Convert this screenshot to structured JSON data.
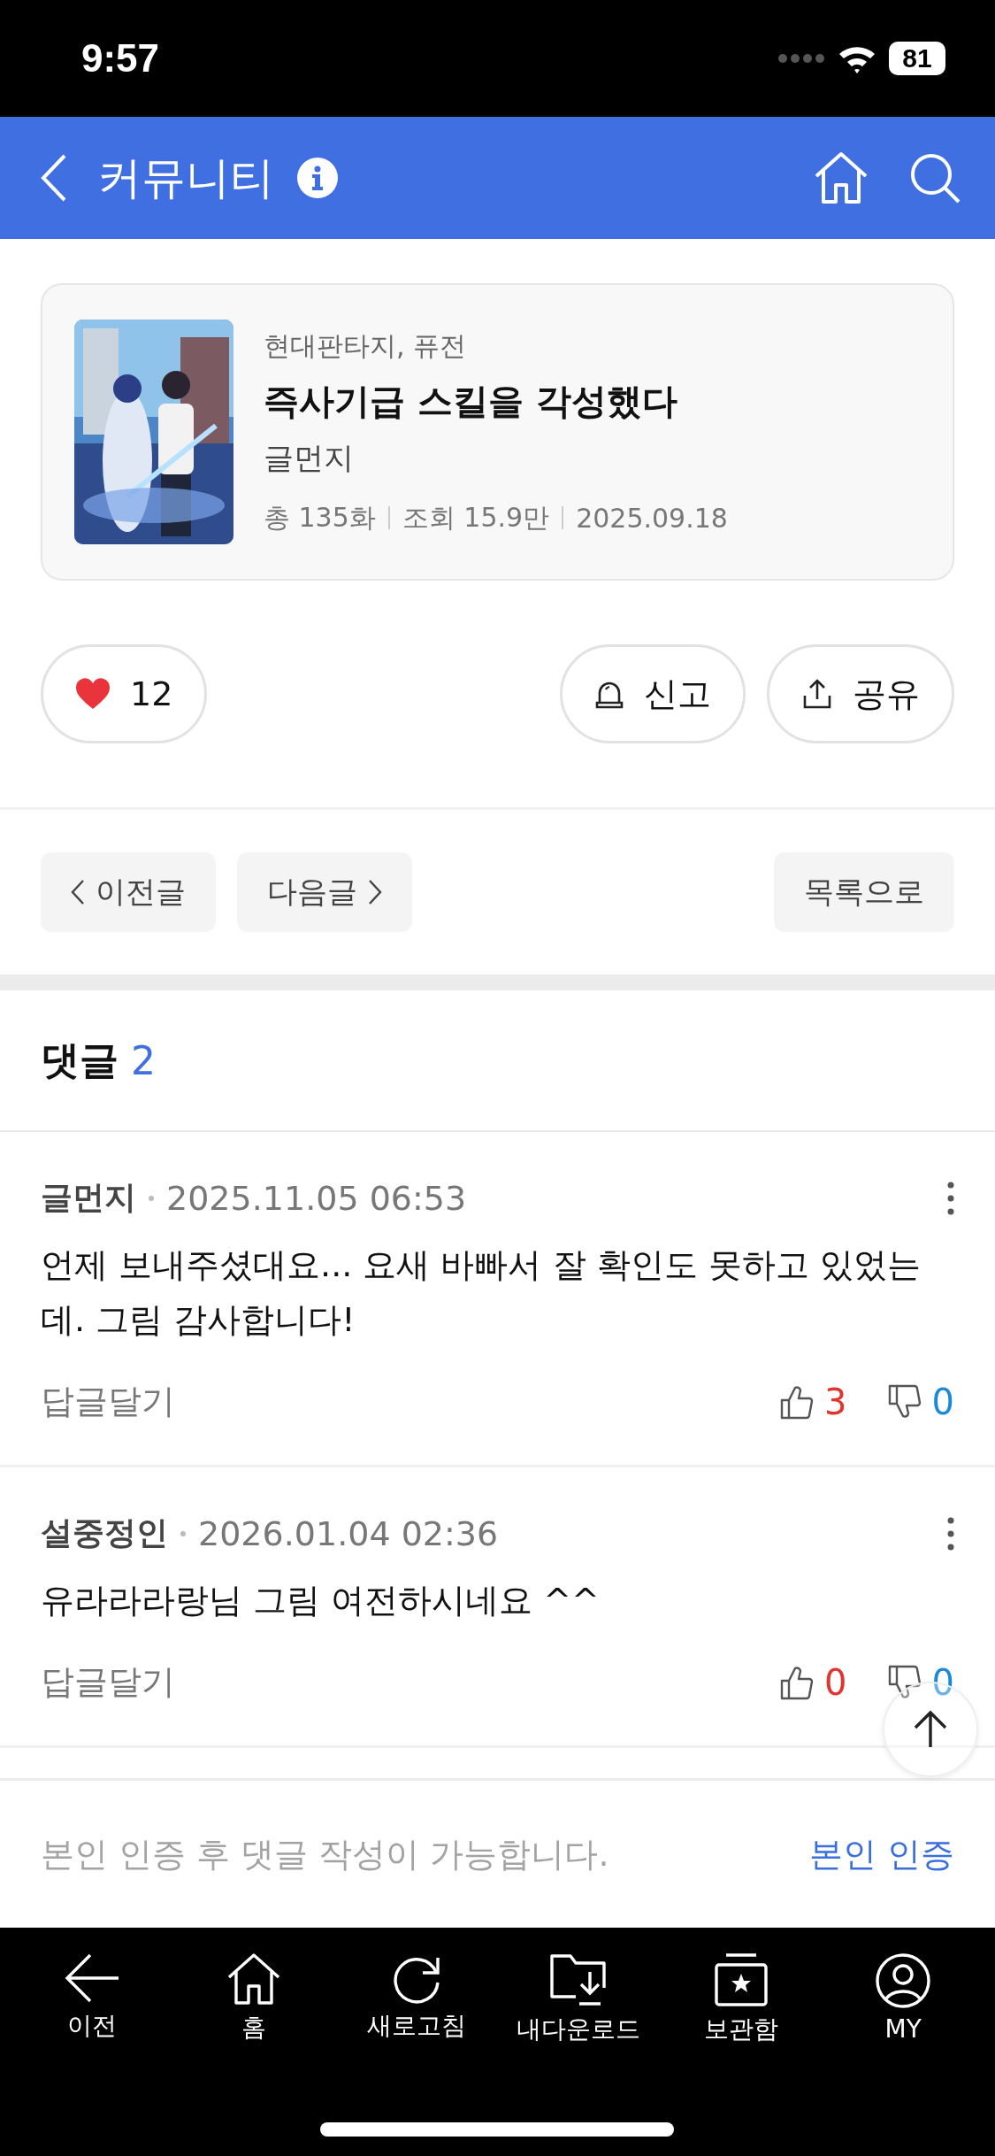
{
  "status_bar": {
    "time": "9:57",
    "battery": "81"
  },
  "header": {
    "title": "커뮤니티"
  },
  "work": {
    "genre": "현대판타지, 퓨전",
    "title": "즉사기급 스킬을 각성했다",
    "author": "글먼지",
    "stats": [
      "총 135화",
      "조회 15.9만",
      "2025.09.18"
    ]
  },
  "actions": {
    "likes": "12",
    "report": "신고",
    "share": "공유"
  },
  "post_nav": {
    "previous": "이전글",
    "next": "다음글",
    "list": "목록으로"
  },
  "comments": {
    "title": "댓글",
    "count": "2",
    "items": [
      {
        "author": "글먼지",
        "date": "2025.11.05 06:53",
        "text": "언제 보내주셨대요... 요새 바빠서 잘 확인도 못하고 있었는데. 그림 감사합니다!",
        "reply": "답글달기",
        "likes": "3",
        "dislikes": "0"
      },
      {
        "author": "설중정인",
        "date": "2026.01.04 02:36",
        "text": "유라라라랑님 그림 여전하시네요 ^^",
        "reply": "답글달기",
        "likes": "0",
        "dislikes": "0"
      }
    ]
  },
  "comment_prompt": {
    "text": "본인 인증 후 댓글 작성이 가능합니다.",
    "link": "본인 인증"
  },
  "tab_bar": [
    {
      "kind": "back",
      "label": "이전"
    },
    {
      "kind": "home",
      "label": "홈"
    },
    {
      "kind": "refresh",
      "label": "새로고침"
    },
    {
      "kind": "download",
      "label": "내다운로드"
    },
    {
      "kind": "archive",
      "label": "보관함"
    },
    {
      "kind": "profile",
      "label": "MY"
    }
  ]
}
